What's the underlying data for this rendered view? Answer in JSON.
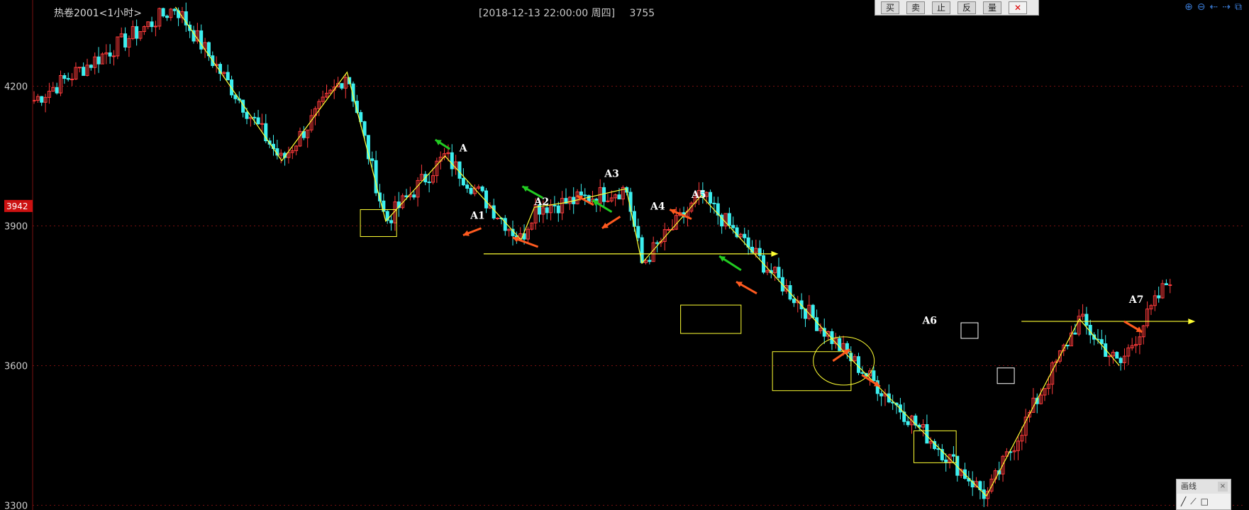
{
  "header": {
    "title": "热卷2001<1小时>",
    "datetime": "[2018-12-13  22:00:00 周四]",
    "value": "3755"
  },
  "toolbar": {
    "buttons": [
      "买",
      "卖",
      "止",
      "反",
      "量"
    ],
    "close": "✕"
  },
  "nav_icons": [
    "zoom-in-icon",
    "zoom-out-icon",
    "arrow-left-icon",
    "arrow-right-icon",
    "restore-icon"
  ],
  "draw_panel": {
    "title": "画线",
    "close": "×"
  },
  "colors": {
    "up": "#ff3b3b",
    "down": "#3cf0f0",
    "zigzag": "#ffff33",
    "orange_arrow": "#ff5a1f",
    "green_arrow": "#22cc22",
    "price_tag": "#cc1111"
  },
  "chart_data": {
    "type": "candlestick",
    "ylim": [
      3290,
      4385
    ],
    "y_ticks": [
      4200,
      3900,
      3600,
      3300
    ],
    "price_tag": 3942,
    "grid": true,
    "zigzag_points": [
      [
        0.117,
        4370
      ],
      [
        0.205,
        4040
      ],
      [
        0.259,
        4230
      ],
      [
        0.291,
        3910
      ],
      [
        0.34,
        4050
      ],
      [
        0.403,
        3870
      ],
      [
        0.414,
        3940
      ],
      [
        0.44,
        3950
      ],
      [
        0.49,
        3980
      ],
      [
        0.503,
        3820
      ],
      [
        0.552,
        3965
      ],
      [
        0.67,
        3630
      ],
      [
        0.788,
        3320
      ],
      [
        0.865,
        3700
      ],
      [
        0.898,
        3600
      ]
    ],
    "trend_levels": [
      {
        "x": [
          0.372,
          0.61
        ],
        "y": 3840,
        "arrow": true
      },
      {
        "x": [
          0.817,
          0.955
        ],
        "y": 3695,
        "arrow": true
      }
    ],
    "annotations": [
      {
        "label": "A",
        "x": 0.352,
        "y": 4060
      },
      {
        "label": "A1",
        "x": 0.361,
        "y": 3915
      },
      {
        "label": "A2",
        "x": 0.414,
        "y": 3945
      },
      {
        "label": "A3",
        "x": 0.472,
        "y": 4005
      },
      {
        "label": "A4",
        "x": 0.51,
        "y": 3935
      },
      {
        "label": "A5",
        "x": 0.544,
        "y": 3960
      },
      {
        "label": "A6",
        "x": 0.735,
        "y": 3690
      },
      {
        "label": "A7",
        "x": 0.906,
        "y": 3735
      }
    ]
  }
}
